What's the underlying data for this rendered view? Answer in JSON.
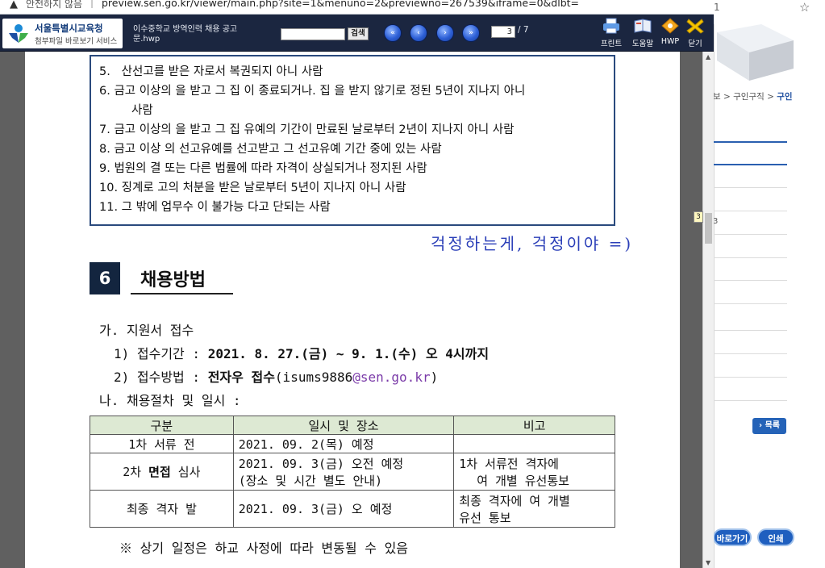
{
  "browser": {
    "warning_icon": "warning-triangle-icon",
    "security_text": "안전하지 않음",
    "separator": "|",
    "url": "preview.sen.go.kr/viewer/main.php?site=1&menuno=2&previewno=267539&iframe=0&dlbt="
  },
  "background_page": {
    "tab_fragment": "1",
    "breadcrumb_prefix": "보 > 구인구직 > ",
    "breadcrumb_current": "구인",
    "side_number": "3",
    "list_button": "› 목록",
    "shortcut_button": "바로가기",
    "print_button": "인쇄"
  },
  "viewer": {
    "logo_title": "서울특별시교육청",
    "logo_subtitle": "첨부파일 바로보기 서비스",
    "document_name": "이수중학교 방역인력 채용 공고문.hwp",
    "search_button": "검색",
    "search_value": "",
    "page_current": "3",
    "page_total": "/ 7",
    "page_tip": "3",
    "tools": [
      {
        "label": "프린트",
        "icon": "printer-icon"
      },
      {
        "label": "도움말",
        "icon": "help-book-icon"
      },
      {
        "label": "HWP",
        "icon": "hwp-file-icon"
      },
      {
        "label": "닫기",
        "icon": "close-icon"
      }
    ],
    "nav": [
      "first-page-icon",
      "prev-page-icon",
      "next-page-icon",
      "last-page-icon"
    ]
  },
  "document": {
    "disqualifications": [
      {
        "num": "5.",
        "text": "산선고를 받은 자로서 복권되지 아니    사람"
      },
      {
        "num": "6.",
        "text": "금고 이상의    을 받고 그 집   이 종료되거나. 집   을 받지 않기로    정된      5년이 지나지 아니"
      },
      {
        "num": "",
        "text": "사람"
      },
      {
        "num": "7.",
        "text": "금고 이상의    을 받고 그 집   유예의 기간이 만료된 날로부터 2년이 지나지 아니    사람"
      },
      {
        "num": "8.",
        "text": "금고 이상   의 선고유예를 선고받고 그 선고유예 기간 중에 있는 사람"
      },
      {
        "num": "9.",
        "text": "법원의     결 또는 다른 법률에 따라 자격이 상실되거나 정지된 사람"
      },
      {
        "num": "10.",
        "text": "징계로    고의 처분을 받은 날로부터 5년이 지나지 아니    사람"
      },
      {
        "num": "11.",
        "text": "그 밖에 업무수   이 불가능   다고    단되는 사람"
      }
    ],
    "handwritten_note": "걱정하는게, 걱정이야 =)",
    "section_number": "6",
    "section_title": "채용방법",
    "item_ga": "가. 지원서 접수",
    "period_label": "1) 접수기간 : ",
    "period_value": "2021. 8. 27.(금) ~ 9. 1.(수) 오  4시까지",
    "method_label": "2) 접수방법 : ",
    "method_bold": "전자우    접수",
    "method_email_pre": "(isums9886",
    "method_email": "@sen.go.kr",
    "method_email_post": ")",
    "item_na": "나. 채용절차 및 일시 :",
    "table": {
      "headers": [
        "구분",
        "일시 및 장소",
        "비고"
      ],
      "rows": [
        {
          "stage": "1차 서류 전",
          "date_line1": "2021. 09. 2(목) 예정",
          "date_line2": "",
          "note_line1": "",
          "note_line2": ""
        },
        {
          "stage_pre": "2차 ",
          "stage_bold": "면접",
          "stage_post": " 심사",
          "date_line1": "2021. 09. 3(금) 오전 예정",
          "date_line2": "(장소 및 시간 별도 안내)",
          "note_line1": "1차  서류전       격자에",
          "note_line2": "여 개별 유선통보"
        },
        {
          "stage": "최종  격자 발",
          "date_line1": "2021. 09. 3(금) 오    예정",
          "date_line2": "",
          "note_line1": "최종  격자에      여 개별",
          "note_line2": "유선 통보"
        }
      ]
    },
    "footnote": "※ 상기 일정은 하교 사정에 따라 변동될 수 있음"
  }
}
